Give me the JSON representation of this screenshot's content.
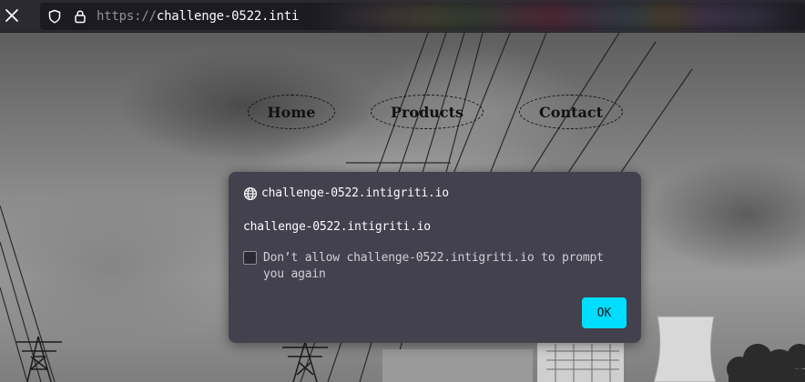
{
  "browser": {
    "url_scheme": "https://",
    "url_host": "challenge-0522.inti",
    "close_icon": "close-icon",
    "shield_icon": "shield-icon",
    "lock_icon": "lock-icon"
  },
  "page": {
    "nav": {
      "home": "Home",
      "products": "Products",
      "contact": "Contact"
    }
  },
  "dialog": {
    "title": "challenge-0522.intigriti.io",
    "message": "challenge-0522.intigriti.io",
    "checkbox_label": "Don’t allow challenge-0522.intigriti.io to prompt you again",
    "checkbox_checked": false,
    "ok_label": "OK",
    "globe_icon": "globe-icon",
    "accent_color": "#00ddff"
  }
}
